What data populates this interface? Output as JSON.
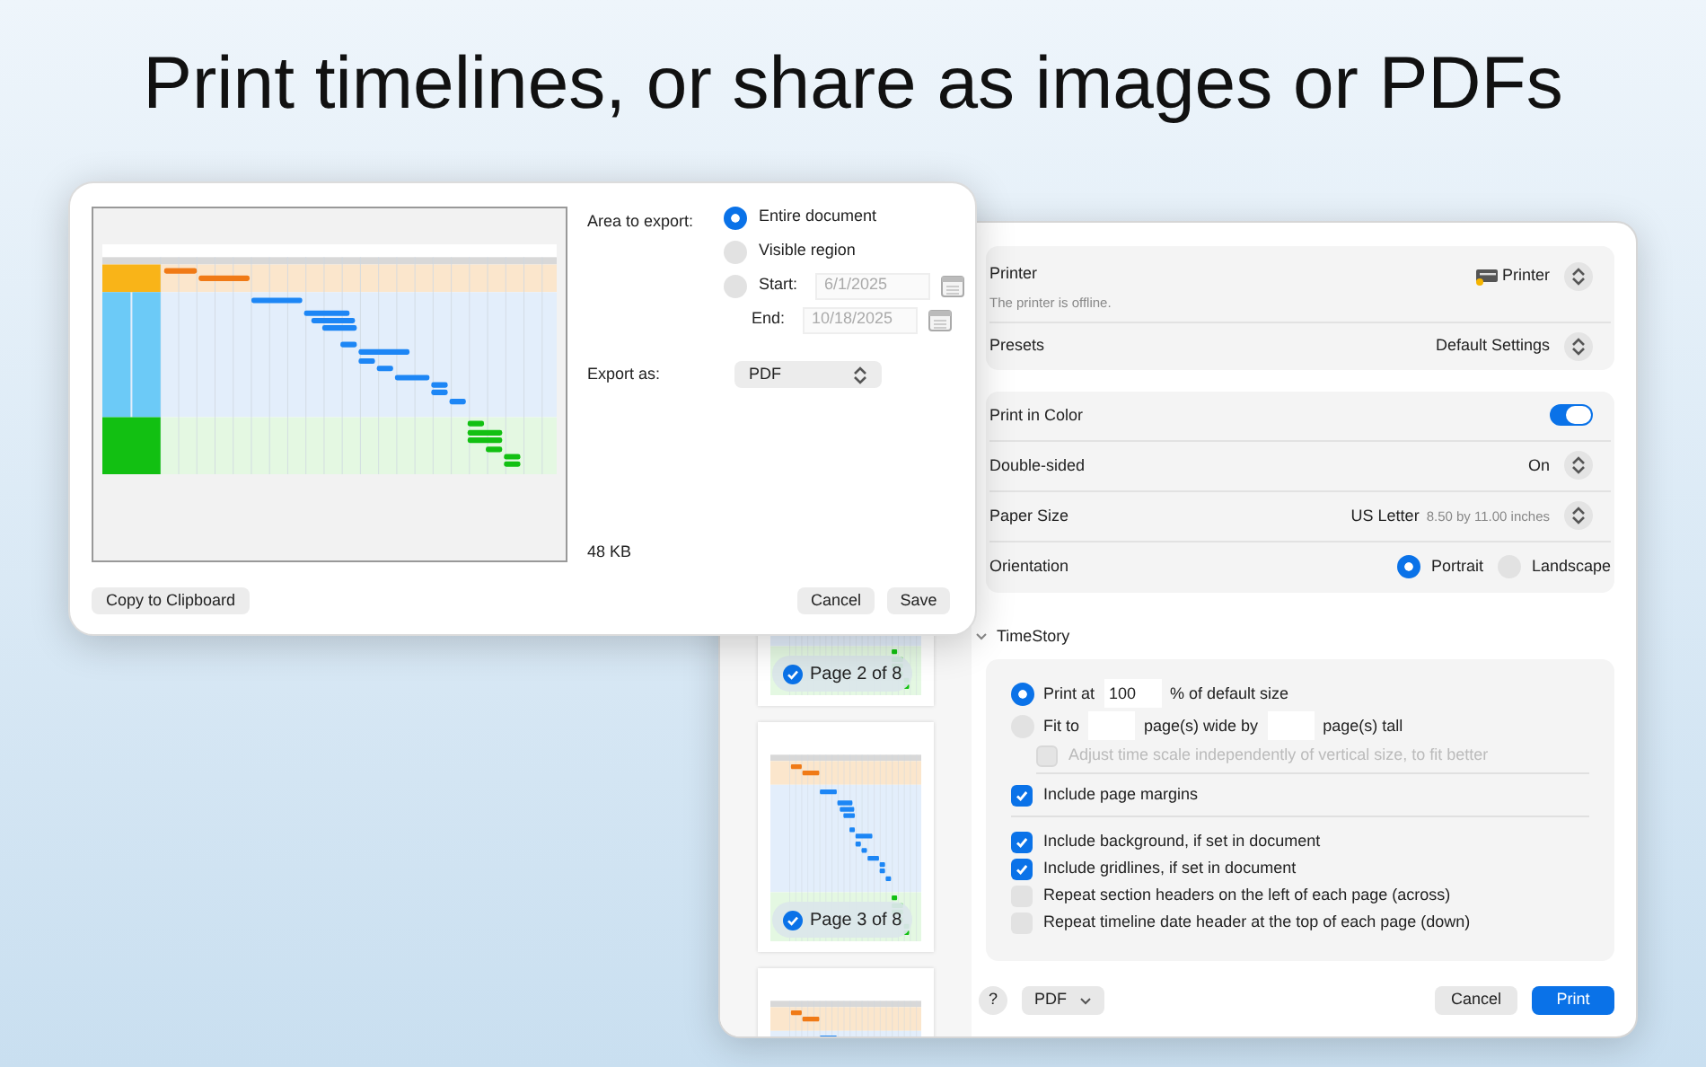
{
  "headline": "Print timelines, or share as images or PDFs",
  "export_dialog": {
    "area_label": "Area to export:",
    "area_options": [
      {
        "label": "Entire document",
        "selected": true
      },
      {
        "label": "Visible region",
        "selected": false
      },
      {
        "label": "Start:",
        "selected": false
      }
    ],
    "start_value": "6/1/2025",
    "end_label": "End:",
    "end_value": "10/18/2025",
    "export_as_label": "Export as:",
    "format": "PDF",
    "file_size": "48 KB",
    "copy_button": "Copy to Clipboard",
    "cancel_button": "Cancel",
    "save_button": "Save"
  },
  "print_dialog": {
    "pages": [
      {
        "label": "Page 2 of 8",
        "checked": true
      },
      {
        "label": "Page 3 of 8",
        "checked": true
      }
    ],
    "printer": {
      "label": "Printer",
      "note": "The printer is offline.",
      "value": "Printer"
    },
    "presets": {
      "label": "Presets",
      "value": "Default Settings"
    },
    "settings": [
      {
        "kind": "toggle",
        "label": "Print in Color",
        "on": true
      },
      {
        "kind": "popup",
        "label": "Double-sided",
        "value": "On"
      },
      {
        "kind": "popup",
        "label": "Paper Size",
        "value": "US Letter",
        "detail": "8.50 by 11.00 inches"
      },
      {
        "kind": "radio",
        "label": "Orientation",
        "options": [
          {
            "label": "Portrait",
            "selected": true
          },
          {
            "label": "Landscape",
            "selected": false
          }
        ]
      }
    ],
    "section_title": "TimeStory",
    "scale_options": [
      {
        "kind": "print_at",
        "selected": true,
        "label": "Print at",
        "value": "100",
        "suffix": "% of default size"
      },
      {
        "kind": "fit_to",
        "selected": false,
        "label": "Fit to",
        "middle": "page(s) wide by",
        "suffix": "page(s) tall"
      }
    ],
    "adjust_option": {
      "label": "Adjust time scale independently of vertical size, to fit better",
      "checked": false,
      "disabled": true
    },
    "margins_option": {
      "label": "Include page margins",
      "checked": true
    },
    "options": [
      {
        "label": "Include background, if set in document",
        "checked": true
      },
      {
        "label": "Include gridlines, if set in document",
        "checked": true
      },
      {
        "label": "Repeat section headers on the left of each page (across)",
        "checked": false
      },
      {
        "label": "Repeat timeline date header at the top of each page (down)",
        "checked": false
      }
    ],
    "help_button": "?",
    "pdf_button": "PDF",
    "cancel_button": "Cancel",
    "print_button": "Print"
  }
}
